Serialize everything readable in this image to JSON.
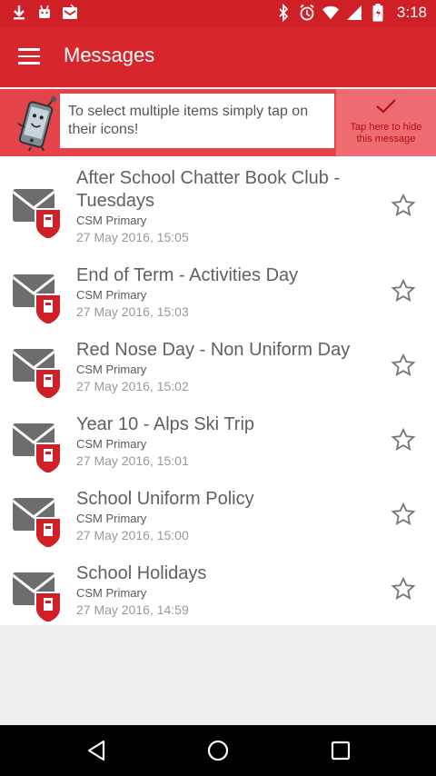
{
  "status_bar": {
    "time": "3:18",
    "left_icons": [
      "download-icon",
      "android-icon",
      "mail-notification-icon"
    ],
    "right_icons": [
      "bluetooth-icon",
      "alarm-icon",
      "wifi-icon",
      "signal-icon",
      "battery-icon"
    ]
  },
  "app_bar": {
    "title": "Messages",
    "menu_icon": "hamburger-menu-icon"
  },
  "hint": {
    "text": "To select multiple items simply tap on their icons!",
    "dismiss_label": "Tap here to hide this message"
  },
  "messages": [
    {
      "title": "After School Chatter Book Club - Tuesdays",
      "sender": "CSM Primary",
      "date": "27 May 2016, 15:05",
      "starred": false
    },
    {
      "title": "End of Term - Activities Day",
      "sender": "CSM Primary",
      "date": "27 May 2016, 15:03",
      "starred": false
    },
    {
      "title": "Red Nose Day - Non Uniform Day",
      "sender": "CSM Primary",
      "date": "27 May 2016, 15:02",
      "starred": false
    },
    {
      "title": "Year 10 - Alps Ski Trip",
      "sender": "CSM Primary",
      "date": "27 May 2016, 15:01",
      "starred": false
    },
    {
      "title": "School Uniform Policy",
      "sender": "CSM Primary",
      "date": "27 May 2016, 15:00",
      "starred": false
    },
    {
      "title": "School Holidays",
      "sender": "CSM Primary",
      "date": "27 May 2016, 14:59",
      "starred": false
    }
  ],
  "nav_bar": {
    "buttons": [
      "back-icon",
      "home-icon",
      "recents-icon"
    ]
  },
  "colors": {
    "status_bar": "#cf2027",
    "app_bar": "#d8262d",
    "hint_bar": "#e4434a",
    "hint_dismiss": "#ef6d72",
    "badge_red": "#d01f26"
  }
}
